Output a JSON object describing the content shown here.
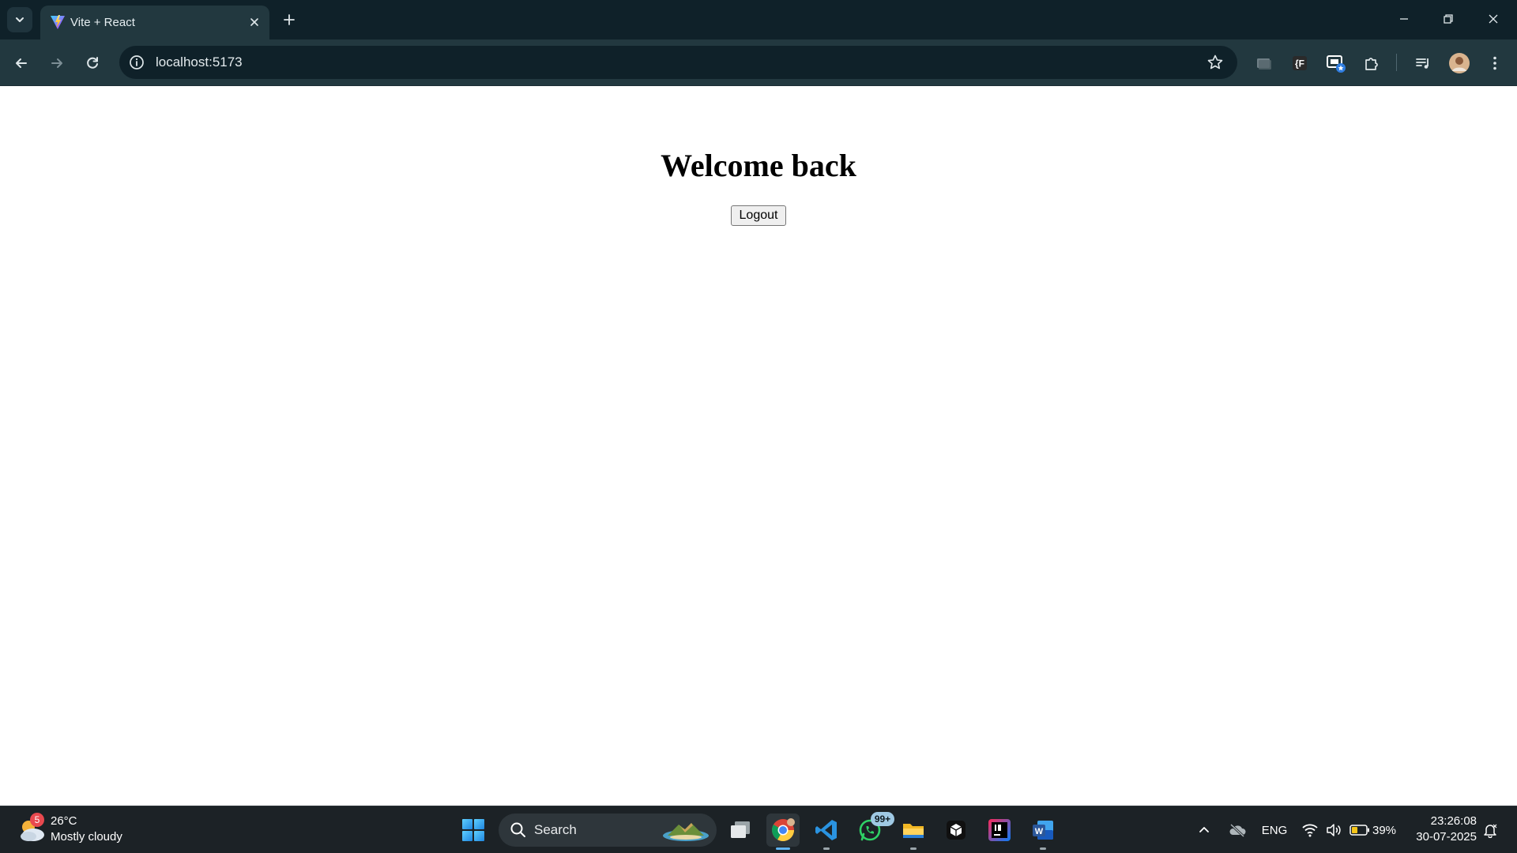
{
  "browser": {
    "tab_title": "Vite + React",
    "url": "localhost:5173",
    "icons": {
      "tab_search": "chevron-down-icon",
      "favicon": "vite-logo-icon",
      "tab_close": "close-icon",
      "new_tab": "plus-icon",
      "back": "arrow-left-icon",
      "forward": "arrow-right-icon",
      "reload": "reload-icon",
      "site_info": "info-icon",
      "bookmark": "star-icon",
      "extensions": [
        "window-icon",
        "f-extension-icon",
        "screen-share-icon",
        "puzzle-icon"
      ],
      "media": "media-queue-icon",
      "profile": "avatar",
      "menu": "kebab-menu-icon"
    },
    "accent": "#22383f"
  },
  "page": {
    "heading": "Welcome back",
    "logout_label": "Logout"
  },
  "taskbar": {
    "weather": {
      "badge": "5",
      "temp": "26°C",
      "desc": "Mostly cloudy"
    },
    "search_label": "Search",
    "apps": [
      "start",
      "task-view",
      "chrome",
      "vscode",
      "whatsapp",
      "file-explorer",
      "app-box",
      "intellij",
      "word"
    ],
    "whatsapp_badge": "99+",
    "tray": {
      "language": "ENG",
      "battery": "39%"
    },
    "clock": {
      "time": "23:26:08",
      "date": "30-07-2025"
    }
  }
}
